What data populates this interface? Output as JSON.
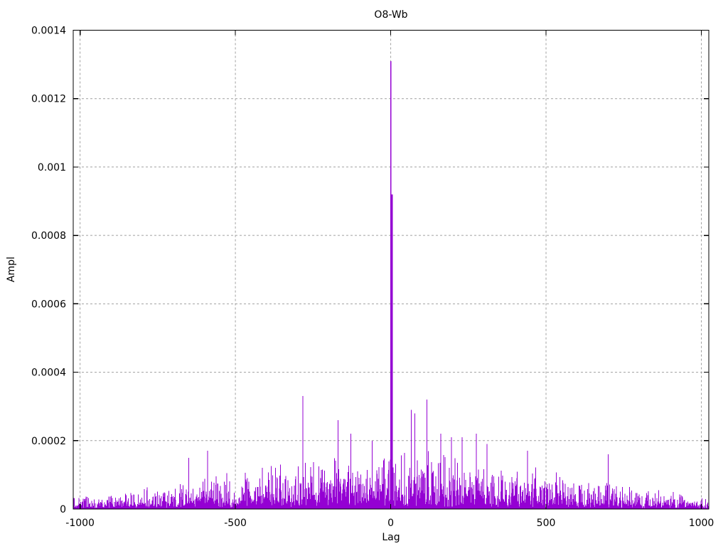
{
  "chart_data": {
    "type": "line",
    "style": "impulses",
    "title": "O8-Wb",
    "xlabel": "Lag",
    "ylabel": "Ampl",
    "xlim": [
      -1022,
      1024
    ],
    "ylim": [
      0,
      0.0014
    ],
    "xticks": [
      {
        "v": -1000,
        "label": "-1000"
      },
      {
        "v": -500,
        "label": "-500"
      },
      {
        "v": 0,
        "label": "0"
      },
      {
        "v": 500,
        "label": "500"
      },
      {
        "v": 1000,
        "label": "1000"
      }
    ],
    "yticks": [
      {
        "v": 0,
        "label": "0"
      },
      {
        "v": 0.0002,
        "label": "0.0002"
      },
      {
        "v": 0.0004,
        "label": "0.0004"
      },
      {
        "v": 0.0006,
        "label": "0.0006"
      },
      {
        "v": 0.0008,
        "label": "0.0008"
      },
      {
        "v": 0.001,
        "label": "0.001"
      },
      {
        "v": 0.0012,
        "label": "0.0012"
      },
      {
        "v": 0.0014,
        "label": "0.0014"
      }
    ],
    "grid": true,
    "legend_position": "none",
    "colors": {
      "series": "#9400d3",
      "grid": "#a0a0a0",
      "axis": "#000000",
      "background": "#ffffff"
    },
    "main_peak": {
      "lag": 0,
      "value": 0.00131
    },
    "secondary_peak": {
      "lag": 3,
      "value": 0.00092
    },
    "notable_spikes": [
      [
        -650,
        0.00015
      ],
      [
        -590,
        0.00017
      ],
      [
        -283,
        0.00033
      ],
      [
        -170,
        0.00026
      ],
      [
        -128,
        0.00022
      ],
      [
        -60,
        0.0002
      ],
      [
        66,
        0.00029
      ],
      [
        78,
        0.00028
      ],
      [
        117,
        0.00032
      ],
      [
        161,
        0.00022
      ],
      [
        196,
        0.00021
      ],
      [
        230,
        0.00021
      ],
      [
        276,
        0.00022
      ],
      [
        310,
        0.00019
      ],
      [
        440,
        0.00017
      ],
      [
        700,
        0.00016
      ]
    ],
    "noise_envelope": [
      [
        -1022,
        4.5e-05
      ],
      [
        -900,
        5.5e-05
      ],
      [
        -800,
        6.5e-05
      ],
      [
        -700,
        8e-05
      ],
      [
        -600,
        0.0001
      ],
      [
        -500,
        0.00012
      ],
      [
        -400,
        0.00013
      ],
      [
        -300,
        0.00015
      ],
      [
        -200,
        0.00016
      ],
      [
        -100,
        0.00017
      ],
      [
        0,
        0.00018
      ],
      [
        100,
        0.00018
      ],
      [
        200,
        0.00017
      ],
      [
        300,
        0.00015
      ],
      [
        400,
        0.00014
      ],
      [
        500,
        0.00012
      ],
      [
        600,
        0.0001
      ],
      [
        700,
        9e-05
      ],
      [
        800,
        6.5e-05
      ],
      [
        900,
        5.5e-05
      ],
      [
        1024,
        4e-05
      ]
    ],
    "noise_seed": 20240917,
    "noise_points": 1800
  }
}
